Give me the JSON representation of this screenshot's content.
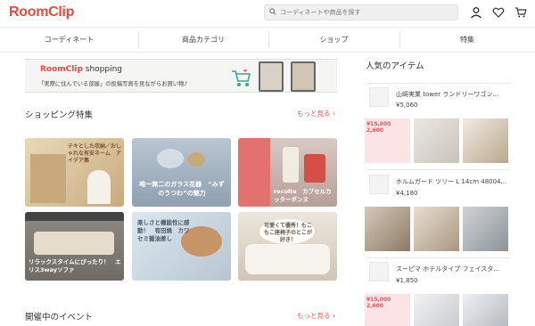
{
  "header": {
    "logo": "RoomClip",
    "search_placeholder": "コーディネートや商品を探す"
  },
  "nav": {
    "items": [
      "コーディネート",
      "商品カテゴリ",
      "ショップ",
      "特集"
    ]
  },
  "banner": {
    "logo_main": "RoomClip",
    "logo_sub": " shopping",
    "text": "「実際に住んでいる部屋」の投稿写真を見ながらお買い物♪"
  },
  "shopping_feature": {
    "title": "ショッピング特集",
    "more": "もっと見る ›",
    "cards": [
      {
        "label": "テキとした収納／おしゃれな有安ネーム　アイデア集"
      },
      {
        "label": "唯一無二のガラス花器　“みずのうつわ”の魅力"
      },
      {
        "label": "recolte　カプセルカッターボンヌ"
      },
      {
        "label": "リラックスタイムにぴったり！　エリス3wayソファ"
      },
      {
        "label": "楽しさと機能性に感動！　有田焼　カワセミ醤油差し"
      },
      {
        "label": "可愛くて優秀！もこもこ座椅子のとこが好き！"
      }
    ]
  },
  "events": {
    "title": "開催中のイベント",
    "more": "もっと見る ›"
  },
  "popular": {
    "title": "人気のアイテム",
    "items": [
      {
        "name": "山崎実業 tower ランドリーワゴン...",
        "price": "¥5,060"
      },
      {
        "name": "ホルムガード ツリー L 14cm 48004...",
        "price": "¥4,180"
      },
      {
        "name": "スーピマ ホテルタイプ フェイスタ...",
        "price": "¥1,850"
      }
    ],
    "sale_badge_1": "¥15,000\n2,600",
    "sale_badge_2": "¥15,000\n2,600",
    "sale_badge_3": "¥15,000\n2,600"
  }
}
